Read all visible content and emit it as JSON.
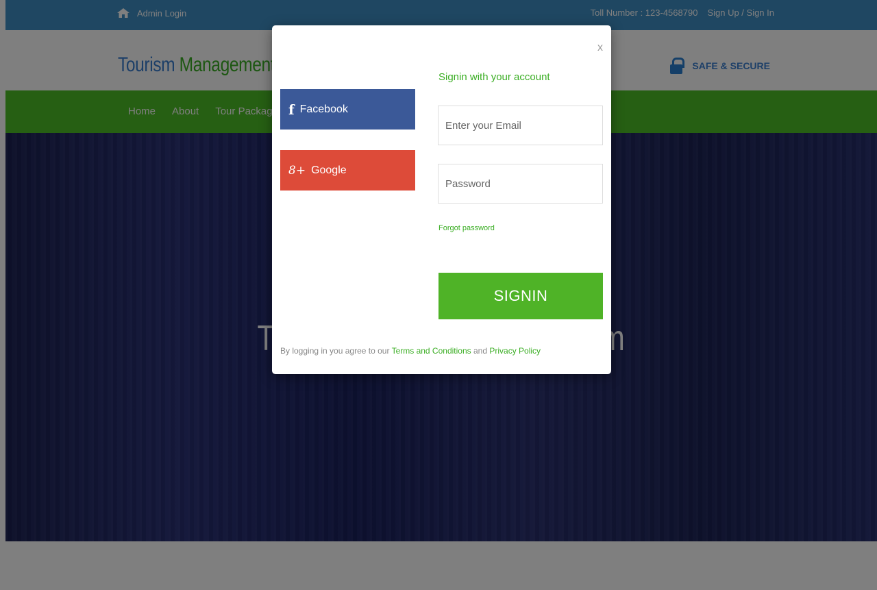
{
  "topbar": {
    "admin_login": "Admin Login",
    "toll_number": "Toll Number : 123-4568790",
    "signup_signin": "Sign Up / Sign In"
  },
  "header": {
    "logo_part1": "Tourism",
    "logo_part2": "Management",
    "secure_label": "SAFE & SECURE"
  },
  "nav": {
    "items": [
      "Home",
      "About",
      "Tour Packages"
    ]
  },
  "hero": {
    "title_left": "TM",
    "title_right": "em"
  },
  "modal": {
    "close_label": "x",
    "facebook_label": "Facebook",
    "google_label": "Google",
    "facebook_icon": "f",
    "google_icon": "8+",
    "title": "Signin with your account",
    "email_placeholder": "Enter your Email",
    "password_placeholder": "Password",
    "forgot_password": "Forgot password",
    "signin_button": "SIGNIN",
    "agree_prefix": "By logging in you agree to our",
    "terms_link": "Terms and Conditions",
    "agree_and": "and",
    "privacy_link": "Privacy Policy"
  },
  "colors": {
    "topbar": "#3f8fc5",
    "nav_green": "#4dbe27",
    "facebook": "#3b5998",
    "google": "#dd4b39",
    "signin_green": "#4fb327",
    "accent_green": "#3bae24",
    "logo_blue": "#3a7fd0"
  }
}
